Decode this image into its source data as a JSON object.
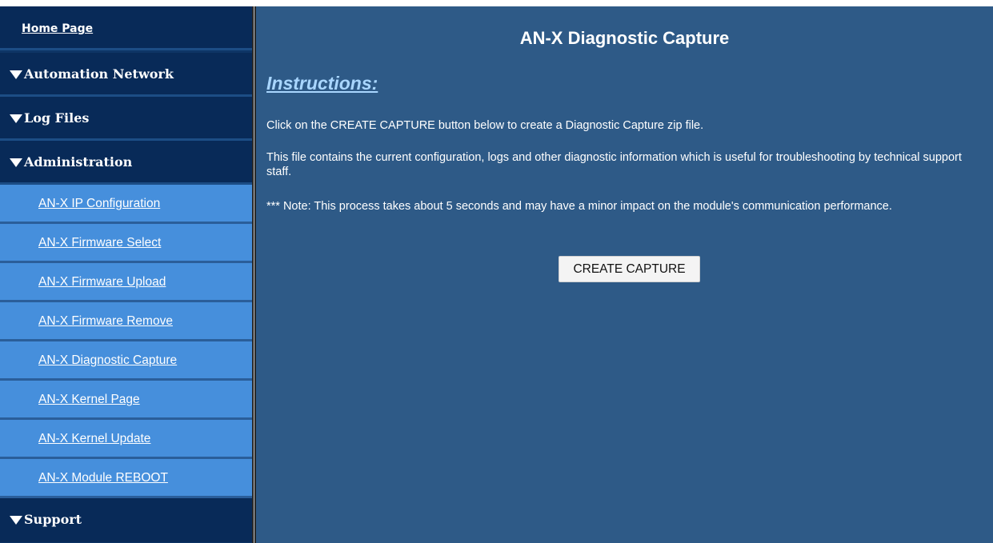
{
  "sidebar": {
    "home_label": "Home Page",
    "sections": {
      "automation_network": "Automation Network",
      "log_files": "Log Files",
      "administration": "Administration",
      "support": "Support"
    },
    "admin_items": [
      "AN-X IP Configuration",
      "AN-X Firmware Select",
      "AN-X Firmware Upload",
      "AN-X Firmware Remove",
      "AN-X Diagnostic Capture",
      "AN-X Kernel Page",
      "AN-X Kernel Update",
      "AN-X Module REBOOT"
    ]
  },
  "main": {
    "title": "AN-X Diagnostic Capture",
    "instructions_heading": "Instructions:",
    "paragraph_1": "Click on the CREATE CAPTURE button below to create a Diagnostic Capture zip file.",
    "paragraph_2": "This file contains the current configuration, logs and other diagnostic information which is useful for troubleshooting by technical support staff.",
    "paragraph_3": "*** Note: This process takes about 5 seconds and may have a minor impact on the module's communication performance.",
    "create_button_label": "CREATE CAPTURE"
  },
  "colors": {
    "sidebar_bg": "#082a58",
    "sub_item_bg": "#468fdc",
    "main_bg": "#2e5a87",
    "heading_accent": "#a9d6ff"
  }
}
